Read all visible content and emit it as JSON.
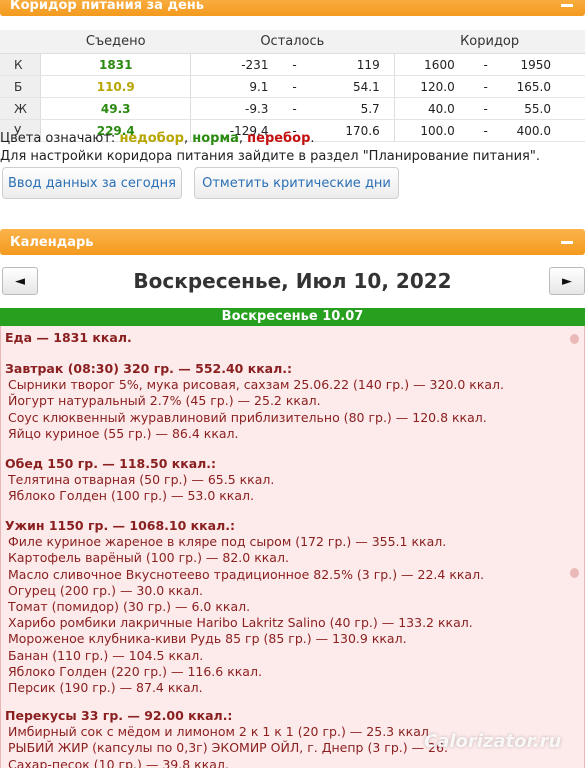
{
  "corridor_panel": {
    "title": "Коридор питания за день",
    "headers": {
      "eaten": "Съедено",
      "remaining": "Осталось",
      "corridor": "Коридор"
    },
    "rows": [
      {
        "label": "К",
        "eaten": "1831",
        "status": "norm",
        "rem_min": "-231",
        "rem_max": "119",
        "cor_min": "1600",
        "cor_max": "1950"
      },
      {
        "label": "Б",
        "eaten": "110.9",
        "status": "under",
        "rem_min": "9.1",
        "rem_max": "54.1",
        "cor_min": "120.0",
        "cor_max": "165.0"
      },
      {
        "label": "Ж",
        "eaten": "49.3",
        "status": "norm",
        "rem_min": "-9.3",
        "rem_max": "5.7",
        "cor_min": "40.0",
        "cor_max": "55.0"
      },
      {
        "label": "У",
        "eaten": "229.4",
        "status": "norm",
        "rem_min": "-129.4",
        "rem_max": "170.6",
        "cor_min": "100.0",
        "cor_max": "400.0"
      }
    ],
    "dash": "-",
    "legend_prefix": "Цвета означают: ",
    "legend_under": "недобор",
    "legend_sep1": ", ",
    "legend_norm": "норма",
    "legend_sep2": ", ",
    "legend_over": "перебор",
    "legend_end": ".",
    "info": "Для настройки коридора питания зайдите в раздел \"Планирование питания\".",
    "btn_today": "Ввод данных за сегодня",
    "btn_critical": "Отметить критические дни",
    "colors": {
      "norm": "#2a8a10",
      "under": "#b7a500",
      "over": "#c41010",
      "header": "#f5a02a"
    }
  },
  "calendar": {
    "title": "Календарь",
    "prev": "◄",
    "next": "►",
    "date_title": "Воскресенье, Июл 10, 2022",
    "day_banner": "Воскресенье 10.07",
    "total": "Еда — 1831 ккал.",
    "meals": [
      {
        "title": "Завтрак (08:30) 320 гр. — 552.40 ккал.:",
        "items": [
          "Сырники творог 5%, мука рисовая, сахзам 25.06.22 (140 гр.) — 320.0 ккал.",
          "Йогурт натуральный 2.7% (45 гр.) — 25.2 ккал.",
          "Соус клюквенный журавлиновий приблизительно (80 гр.) — 120.8 ккал.",
          "Яйцо куриное (55 гр.) — 86.4 ккал."
        ]
      },
      {
        "title": "Обед 150 гр. — 118.50 ккал.:",
        "items": [
          "Телятина отварная (50 гр.) — 65.5 ккал.",
          "Яблоко Голден (100 гр.) — 53.0 ккал."
        ]
      },
      {
        "title": "Ужин 1150 гр. — 1068.10 ккал.:",
        "items": [
          "Филе куриное жареное в кляре под сыром (172 гр.) — 355.1 ккал.",
          "Картофель варёный (100 гр.) — 82.0 ккал.",
          "Масло сливочное Вкуснотеево традиционное 82.5% (3 гр.) — 22.4 ккал.",
          "Огурец (200 гр.) — 30.0 ккал.",
          "Томат (помидор) (30 гр.) — 6.0 ккал.",
          "Харибо ромбики лакричные Haribo Lakritz Salino (40 гр.) — 133.2 ккал.",
          "Мороженое клубника-киви Рудь 85 гр (85 гр.) — 130.9 ккал.",
          "Банан (110 гр.) — 104.5 ккал.",
          "Яблоко Голден (220 гр.) — 116.6 ккал.",
          "Персик (190 гр.) — 87.4 ккал."
        ]
      },
      {
        "title": "Перекусы 33 гр. — 92.00 ккал.:",
        "items": [
          "Имбирный сок с мёдом и лимоном 2 к 1 к 1 (20 гр.) — 25.3 ккал.",
          "РЫБИЙ ЖИР (капсулы по 0,3г) ЭКОМИР ОЙЛ, г. Днепр (3 гр.) — 26.",
          "Сахар-песок (10 гр.) — 39.8 ккал."
        ]
      }
    ]
  },
  "watermark": "Calorizator.ru"
}
